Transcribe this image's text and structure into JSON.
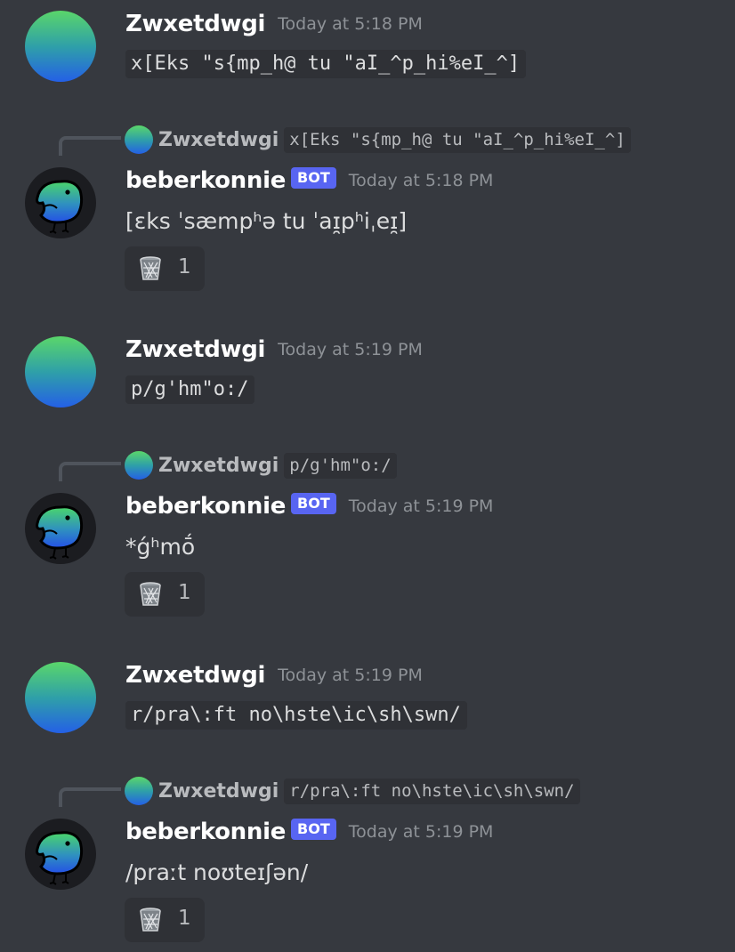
{
  "colors": {
    "background": "#36393f",
    "code_background": "#2f3136",
    "bot_tag": "#5865f2",
    "username": "#ffffff",
    "timestamp": "#8e9297",
    "text": "#dcddde"
  },
  "messages": [
    {
      "author": "Zwxetdwgi",
      "timestamp": "Today at 5:18 PM",
      "content": "x[Eks \"s{mp_h@ tu \"aI_^p_hi%eI_^]"
    },
    {
      "reply": {
        "author": "Zwxetdwgi",
        "content": "x[Eks \"s{mp_h@ tu \"aI_^p_hi%eI_^]"
      },
      "author": "beberkonnie",
      "bot_tag": "BOT",
      "timestamp": "Today at 5:18 PM",
      "content": "[ɛks ˈsæmpʰə tu ˈaɪ̯pʰiˌeɪ̯]",
      "reaction": {
        "icon": "wastebasket-icon",
        "count": "1"
      }
    },
    {
      "author": "Zwxetdwgi",
      "timestamp": "Today at 5:19 PM",
      "content": "p/g'hm\"o:/"
    },
    {
      "reply": {
        "author": "Zwxetdwgi",
        "content": "p/g'hm\"o:/"
      },
      "author": "beberkonnie",
      "bot_tag": "BOT",
      "timestamp": "Today at 5:19 PM",
      "content": "*ǵʰmṓ",
      "reaction": {
        "icon": "wastebasket-icon",
        "count": "1"
      }
    },
    {
      "author": "Zwxetdwgi",
      "timestamp": "Today at 5:19 PM",
      "content": "r/pra\\:ft no\\hste\\ic\\sh\\swn/"
    },
    {
      "reply": {
        "author": "Zwxetdwgi",
        "content": "r/pra\\:ft no\\hste\\ic\\sh\\swn/"
      },
      "author": "beberkonnie",
      "bot_tag": "BOT",
      "timestamp": "Today at 5:19 PM",
      "content": "/praːt noʊteɪʃən/",
      "reaction": {
        "icon": "wastebasket-icon",
        "count": "1"
      }
    }
  ]
}
